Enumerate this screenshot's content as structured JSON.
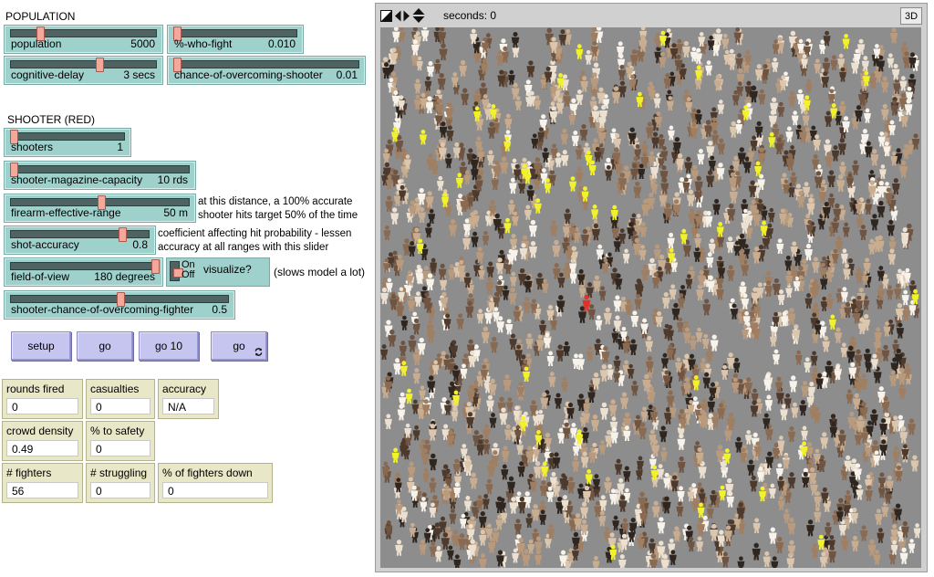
{
  "sections": {
    "population": "POPULATION",
    "shooter": "SHOOTER (RED)"
  },
  "sliders": {
    "population": {
      "label": "population",
      "value": "5000",
      "position": 0.2
    },
    "who_fight": {
      "label": "%-who-fight",
      "value": "0.010",
      "position": 0.0
    },
    "cognitive_delay": {
      "label": "cognitive-delay",
      "value": "3 secs",
      "position": 0.6
    },
    "overcoming_shooter": {
      "label": "chance-of-overcoming-shooter",
      "value": "0.01",
      "position": 0.0
    },
    "shooters": {
      "label": "shooters",
      "value": "1",
      "position": 0.0
    },
    "magazine": {
      "label": "shooter-magazine-capacity",
      "value": "10 rds",
      "position": 0.0
    },
    "firearm_range": {
      "label": "firearm-effective-range",
      "value": "50 m",
      "position": 0.5
    },
    "shot_accuracy": {
      "label": "shot-accuracy",
      "value": "0.8",
      "position": 0.8
    },
    "field_of_view": {
      "label": "field-of-view",
      "value": "180 degrees",
      "position": 1.0
    },
    "shooter_overcoming_fighter": {
      "label": "shooter-chance-of-overcoming-fighter",
      "value": "0.5",
      "position": 0.5
    }
  },
  "notes": {
    "range_line1": "at this distance, a 100% accurate",
    "range_line2": "shooter hits target 50% of the time",
    "accuracy_line1": "coefficient affecting hit probability - lessen",
    "accuracy_line2": "accuracy at all ranges with this slider",
    "visualize": "(slows model a lot)"
  },
  "switch": {
    "on": "On",
    "off": "Off",
    "label": "visualize?",
    "state": "off"
  },
  "buttons": {
    "setup": "setup",
    "go": "go",
    "go10": "go 10",
    "go_forever": "go"
  },
  "monitors": {
    "rounds_fired": {
      "label": "rounds fired",
      "value": "0"
    },
    "casualties": {
      "label": "casualties",
      "value": "0"
    },
    "accuracy": {
      "label": "accuracy",
      "value": "N/A"
    },
    "crowd_density": {
      "label": "crowd density",
      "value": "0.49"
    },
    "to_safety": {
      "label": "% to safety",
      "value": "0"
    },
    "fighters": {
      "label": "# fighters",
      "value": "56"
    },
    "struggling": {
      "label": "# struggling",
      "value": "0"
    },
    "fighters_down": {
      "label": "% of fighters down",
      "value": "0"
    }
  },
  "view": {
    "ticks_label": "seconds: 0",
    "btn_3d": "3D",
    "colors": {
      "background": "#8d8d8d",
      "person_tones": [
        "#2f2620",
        "#4d3a2c",
        "#6e5441",
        "#8a6a50",
        "#a07e61",
        "#b99a7c",
        "#c9ad90",
        "#dcc7ae",
        "#ece0d0",
        "#f7f2ea"
      ],
      "fighter": "#f2f22a",
      "shooter": "#e0312a"
    }
  }
}
